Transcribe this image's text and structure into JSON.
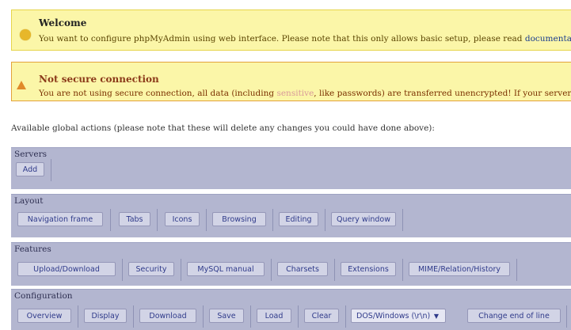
{
  "notices": {
    "welcome": {
      "title": "Welcome",
      "message": "You want to configure phpMyAdmin using web interface. Please note that this only allows basic setup, please read ",
      "link": "documentati"
    },
    "insecure": {
      "title": "Not secure connection",
      "message_a": "You are not using secure connection, all data (including ",
      "message_blur": "sensitive",
      "message_b": ", like passwords) are transferred unencrypted! If your server a"
    }
  },
  "actions_note": "Available global actions (please note that these will delete any changes you could have done above):",
  "sections": {
    "servers": {
      "title": "Servers",
      "buttons": [
        "Add"
      ]
    },
    "layout": {
      "title": "Layout",
      "buttons": [
        "Navigation frame",
        "Tabs",
        "Icons",
        "Browsing",
        "Editing",
        "Query window"
      ]
    },
    "features": {
      "title": "Features",
      "buttons": [
        "Upload/Download",
        "Security",
        "MySQL manual",
        "Charsets",
        "Extensions",
        "MIME/Relation/History"
      ]
    },
    "configuration": {
      "title": "Configuration",
      "buttons": [
        "Overview",
        "Display",
        "Download",
        "Save",
        "Load",
        "Clear"
      ],
      "eol_select": "DOS/Windows (\\r\\n)",
      "change_eol": "Change end of line"
    }
  },
  "colors": {
    "notice_bg": "#fbf6a8",
    "section_bg": "#b3b6d0",
    "button_text": "#2f3a8a"
  },
  "icons": {
    "welcome": "info-dot-icon",
    "insecure": "warning-triangle-icon"
  }
}
